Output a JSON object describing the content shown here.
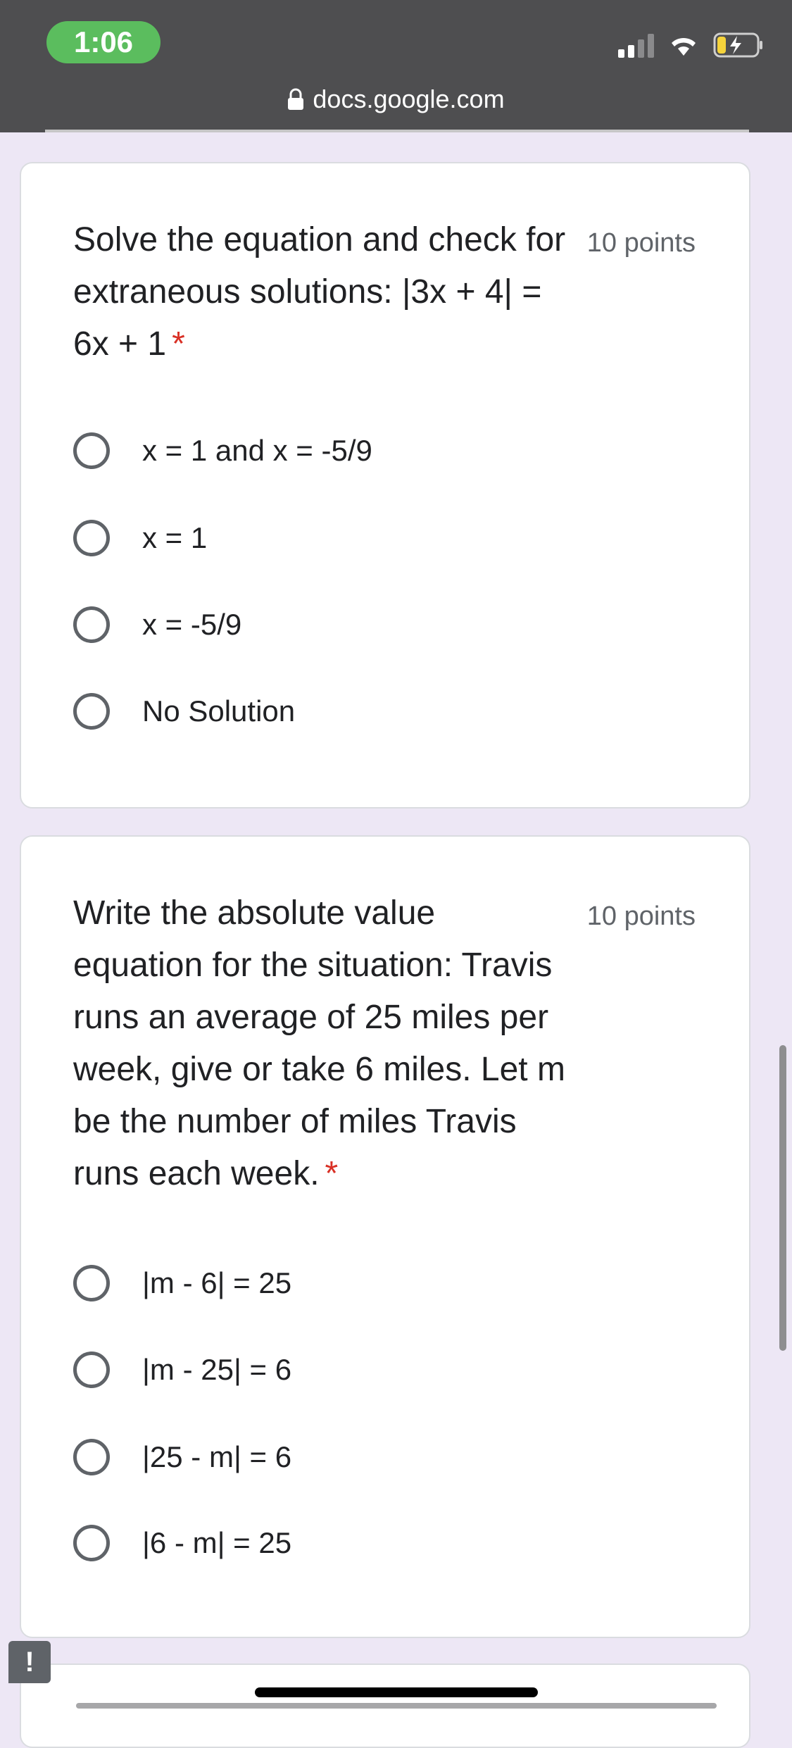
{
  "status_bar": {
    "time": "1:06",
    "url": "docs.google.com"
  },
  "questions": [
    {
      "title": "Solve the equation and check for extraneous solutions: |3x + 4| = 6x + 1",
      "required_mark": "*",
      "points": "10 points",
      "options": [
        "x = 1 and x = -5/9",
        "x = 1",
        "x = -5/9",
        "No Solution"
      ]
    },
    {
      "title": "Write the absolute value equation for the situation: Travis runs an average of 25 miles per week, give or take 6 miles. Let m be the number of miles Travis runs each week.",
      "required_mark": "*",
      "points": "10 points",
      "options": [
        "|m - 6| = 25",
        "|m - 25| = 6",
        "|25 - m| = 6",
        "|6 - m| = 25"
      ]
    }
  ],
  "feedback_button": "!",
  "colors": {
    "status_bar_bg": "#4e4e50",
    "time_pill": "#5bbd5e",
    "page_bg": "#ede7f5",
    "required": "#d93025",
    "battery_fill": "#f5d33b"
  },
  "icons": [
    "signal-icon",
    "wifi-icon",
    "battery-charging-icon",
    "lock-icon",
    "radio-unchecked-icon",
    "feedback-icon"
  ]
}
